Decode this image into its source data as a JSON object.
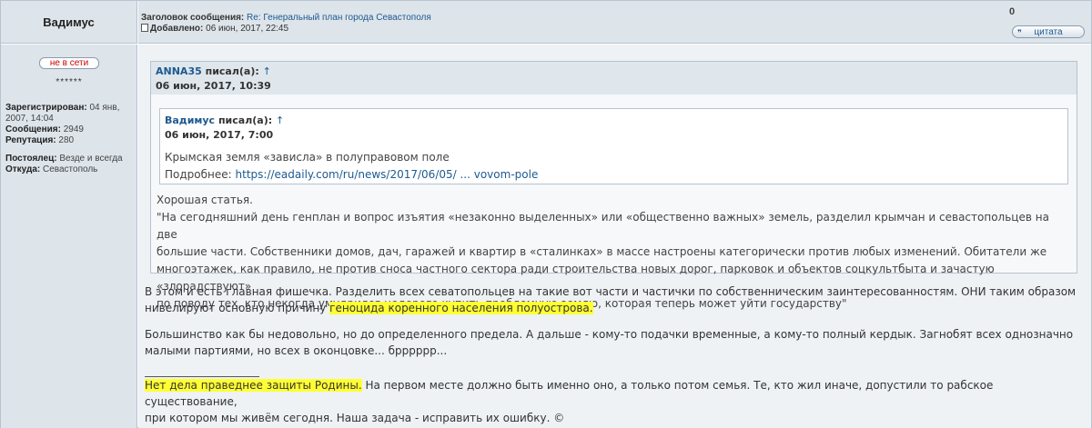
{
  "header": {
    "author_name": "Вадимус",
    "subject_label": "Заголовок сообщения:",
    "subject_value": "Re: Генеральный план города Севастополя",
    "added_label": "Добавлено:",
    "added_value": "06 июн, 2017, 22:45",
    "rating": "0",
    "quote_button": "цитата"
  },
  "profile": {
    "status": "не в сети",
    "rank_stars": "******",
    "registered_label": "Зарегистрирован:",
    "registered_value": "04 янв, 2007, 14:04",
    "posts_label": "Сообщения:",
    "posts_value": "2949",
    "reputation_label": "Репутация:",
    "reputation_value": "280",
    "resident_label": "Постоялец:",
    "resident_value": "Везде и всегда",
    "from_label": "Откуда:",
    "from_value": "Севастополь"
  },
  "quote1": {
    "author": "ANNA35",
    "wrote": "писал(а):",
    "arrow": "↑",
    "date": "06 июн, 2017, 10:39",
    "text_line1": "Хорошая статья.",
    "text_line2": "\"На сегодняшний день генплан и вопрос изъятия «незаконно выделенных» или «общественно важных» земель, разделил крымчан и севастопольцев на две",
    "text_line3": "большие части. Собственники домов, дач, гаражей и квартир в «сталинках» в массе настроены категорически против любых изменений. Обитатели же",
    "text_line4": "многоэтажек, как правило, не против сноса частного сектора ради строительства новых дорог, парковок и объектов соцкультбыта и зачастую «злорадствуют»",
    "text_line5": "по поводу тех, кто некогда умудрился недорого купить проблемную землю, которая теперь может уйти государству\""
  },
  "quote2": {
    "author": "Вадимус",
    "wrote": "писал(а):",
    "arrow": "↑",
    "date": "06 июн, 2017, 7:00",
    "text_line1": "Крымская земля «зависла» в полуправовом поле",
    "more_label": "Подробнее:",
    "link": "https://eadaily.com/ru/news/2017/06/05/ ... vovom-pole"
  },
  "post": {
    "p1_line1": "В этом и есть главная фишечка. Разделить всех севатопольцев на такие вот части и частички по собственническим заинтересованностям. ОНИ таким образом",
    "p1_line2_a": "нивелируют основную причину ",
    "p1_line2_hl": "геноцида коренного населения полуострова.",
    "p2_line1": "Большинство как бы недовольно, но до определенного предела. А дальше - кому-то подачки временные, а кому-то полный кердык. Загнобят всех однозначно",
    "p2_line2": "малыми партиями, но всех в оконцовке... брррррр...",
    "sig_hl": "Нет дела праведнее защиты Родины.",
    "sig_line1_rest": " На первом месте должно быть именно оно, а только потом семья. Те, кто жил иначе, допустили то рабское существование,",
    "sig_line2": "при котором мы живём сегодня. Наша задача - исправить их ошибку. ©"
  },
  "colors": {
    "highlight": "#ffff33",
    "link": "#1d5a90",
    "offline": "#cc0000",
    "header_bg": "#dde4ea"
  }
}
